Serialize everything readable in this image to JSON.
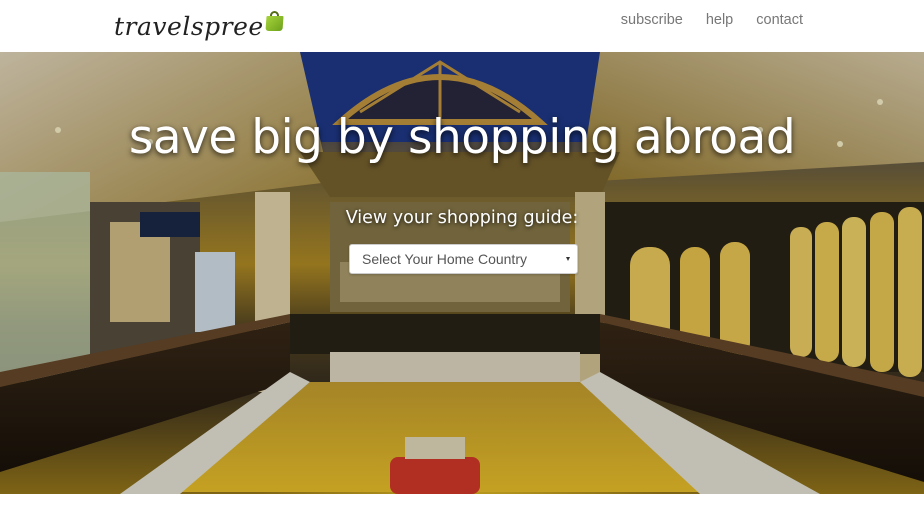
{
  "brand": {
    "name": "travelspree",
    "icon": "shopping-bag-icon",
    "icon_color": "#8cc02a"
  },
  "nav": {
    "items": [
      {
        "label": "subscribe"
      },
      {
        "label": "help"
      },
      {
        "label": "contact"
      }
    ],
    "link_color": "#777777"
  },
  "hero": {
    "title": "save big by shopping abroad",
    "guide_label": "View your shopping guide:",
    "background": "shopping-mall-photo"
  },
  "country_select": {
    "selected": "Select Your Home Country"
  }
}
